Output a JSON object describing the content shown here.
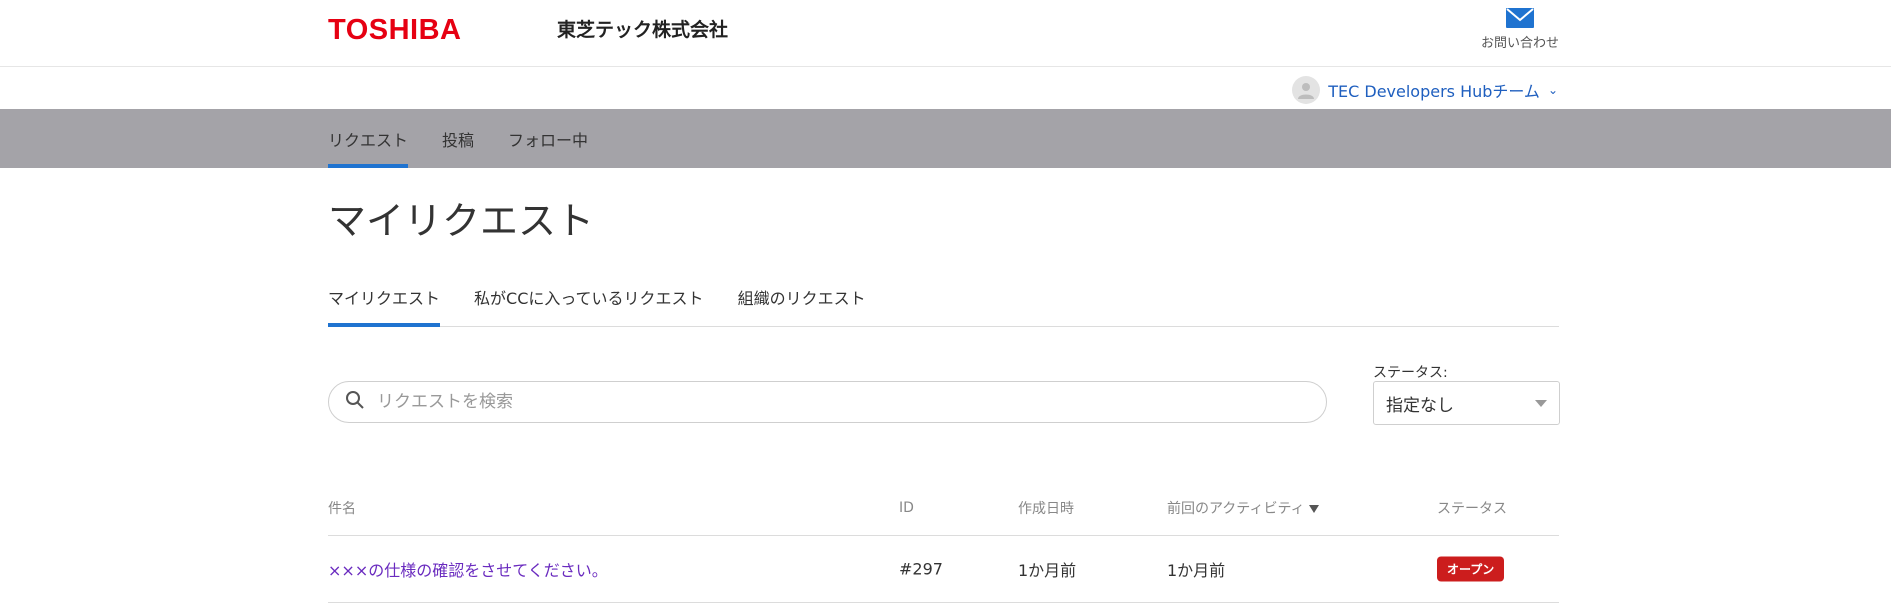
{
  "header": {
    "logo_text": "TOSHIBA",
    "company_name": "東芝テック株式会社",
    "contact_label": "お問い合わせ",
    "brand_color": "#e60012",
    "contact_icon": "mail-icon"
  },
  "user": {
    "name": "TEC Developers Hubチーム",
    "avatar_icon": "user-avatar-icon"
  },
  "nav": {
    "items": [
      {
        "label": "リクエスト",
        "active": true
      },
      {
        "label": "投稿",
        "active": false
      },
      {
        "label": "フォロー中",
        "active": false
      }
    ]
  },
  "page": {
    "title": "マイリクエスト"
  },
  "subtabs": {
    "items": [
      {
        "label": "マイリクエスト",
        "active": true
      },
      {
        "label": "私がCCに入っているリクエスト",
        "active": false
      },
      {
        "label": "組織のリクエスト",
        "active": false
      }
    ]
  },
  "search": {
    "placeholder": "リクエストを検索",
    "value": ""
  },
  "status_filter": {
    "label": "ステータス:",
    "selected": "指定なし"
  },
  "table": {
    "headers": {
      "subject": "件名",
      "id": "ID",
      "created": "作成日時",
      "activity": "前回のアクティビティ",
      "status": "ステータス"
    },
    "rows": [
      {
        "subject": "×××の仕様の確認をさせてください。",
        "id": "#297",
        "created": "1か月前",
        "activity": "1か月前",
        "status": "オープン",
        "status_color": "#cc1d1d"
      }
    ]
  }
}
